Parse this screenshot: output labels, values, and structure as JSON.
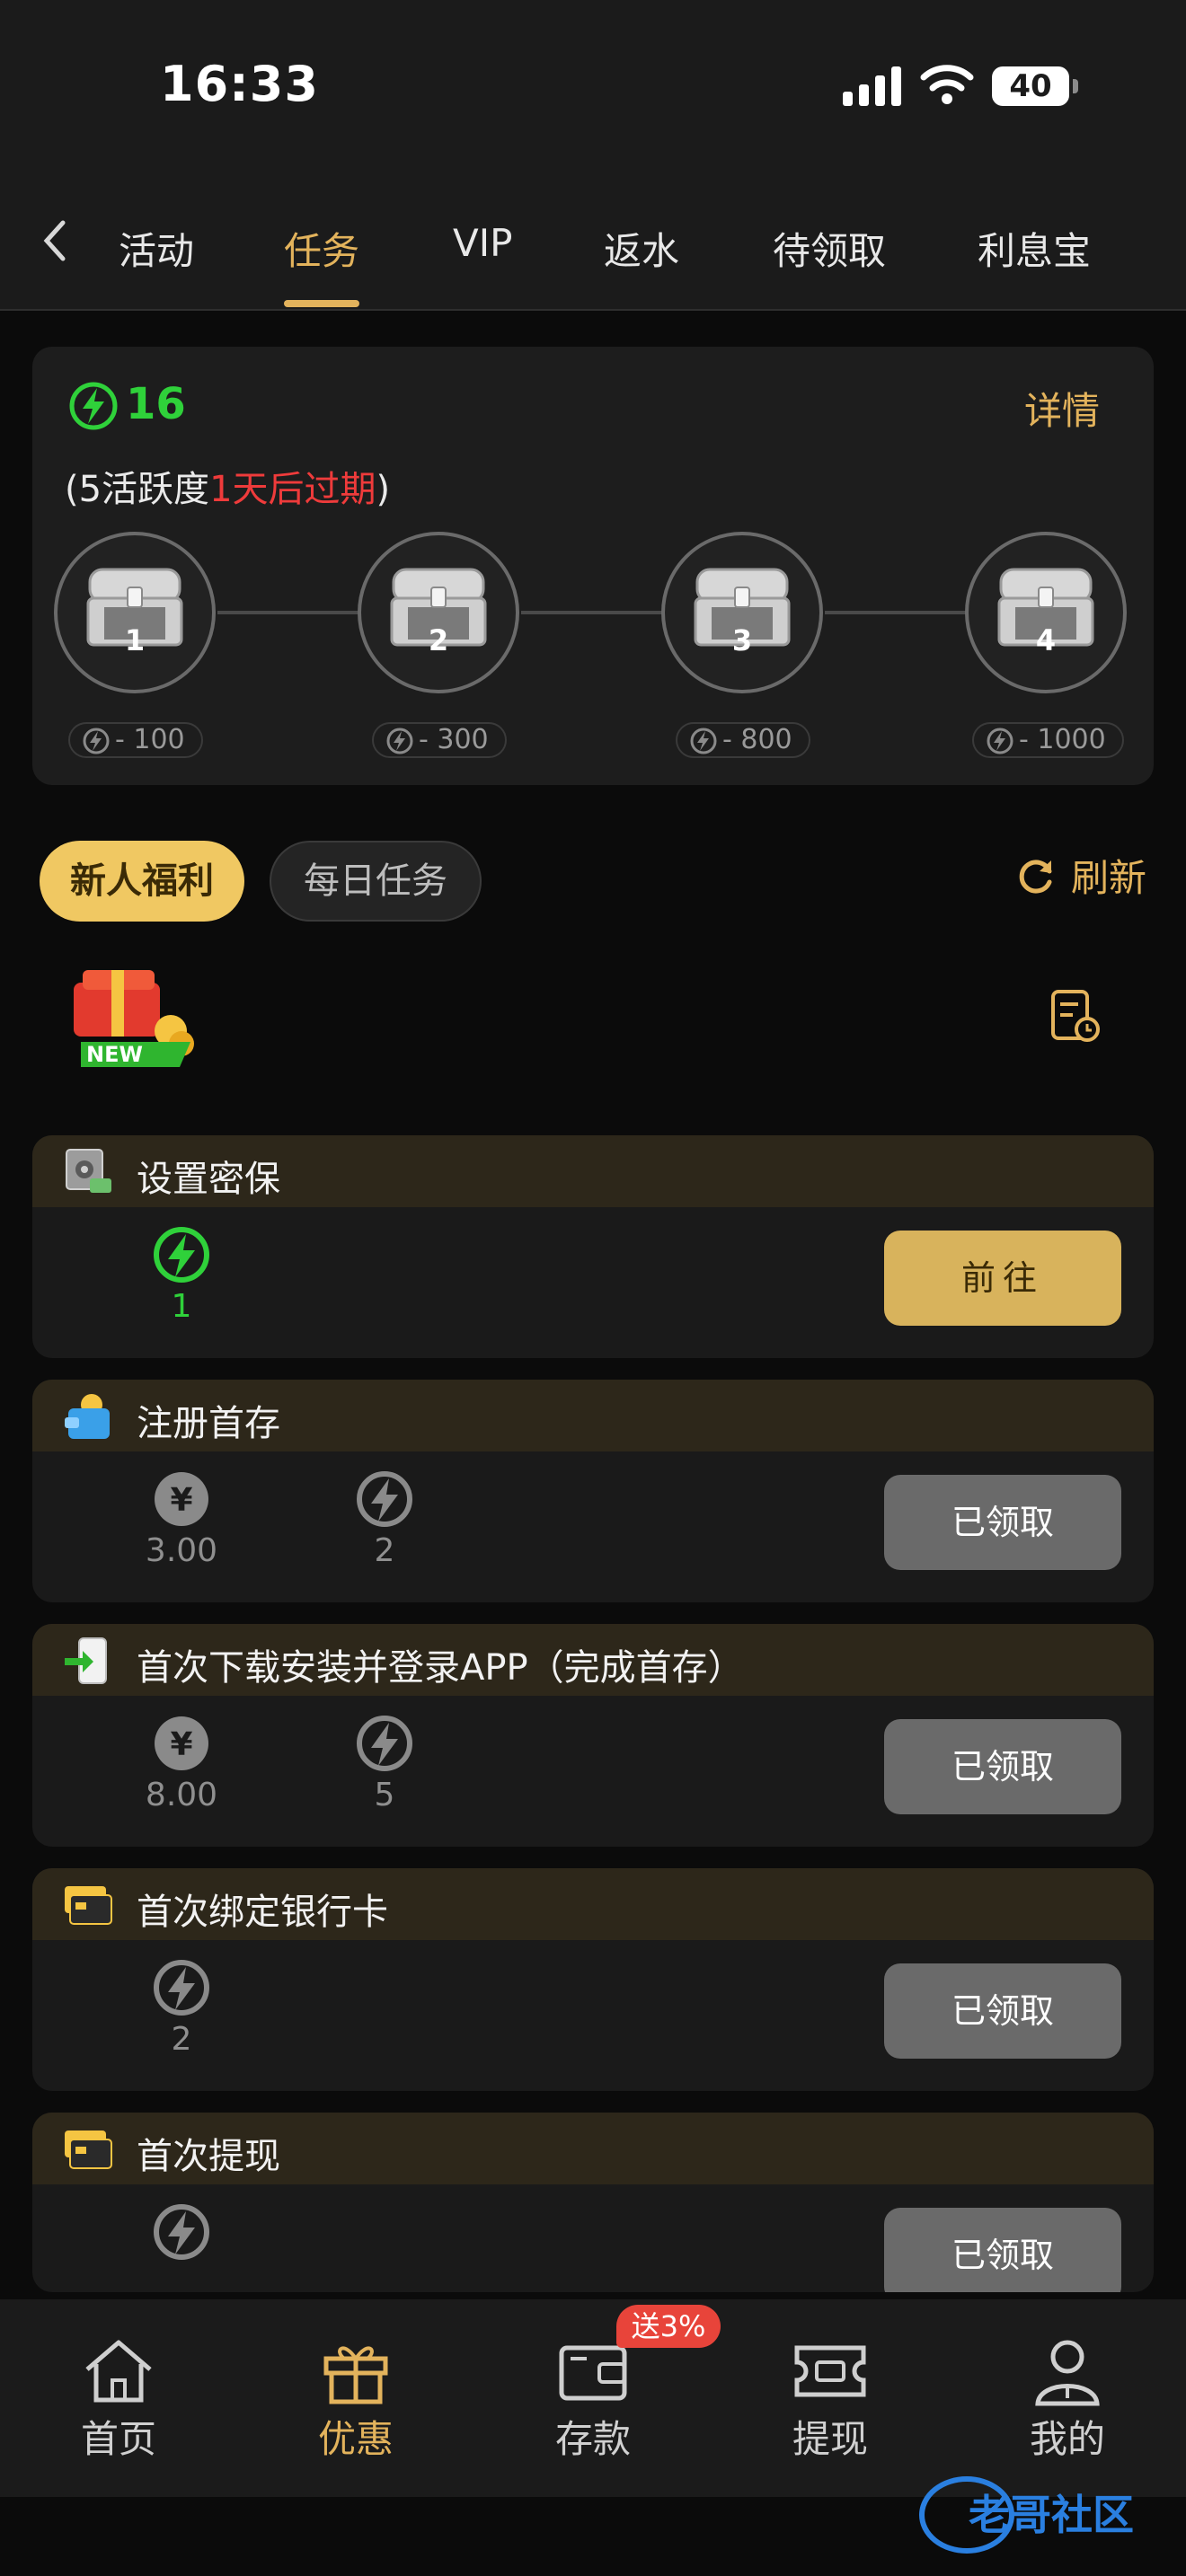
{
  "status_bar": {
    "time": "16:33",
    "battery": "40"
  },
  "tabs": [
    {
      "label": "活动",
      "active": false
    },
    {
      "label": "任务",
      "active": true
    },
    {
      "label": "VIP",
      "active": false
    },
    {
      "label": "返水",
      "active": false
    },
    {
      "label": "待领取",
      "active": false
    },
    {
      "label": "利息宝",
      "active": false
    }
  ],
  "activity": {
    "points": "16",
    "detail_label": "详情",
    "expire_prefix": "(5活跃度",
    "expire_red": "1天后过期",
    "expire_suffix": ")",
    "chests": [
      {
        "num": "1",
        "cost": "- 100"
      },
      {
        "num": "2",
        "cost": "- 300"
      },
      {
        "num": "3",
        "cost": "- 800"
      },
      {
        "num": "4",
        "cost": "- 1000"
      }
    ]
  },
  "filters": {
    "new_user": "新人福利",
    "daily": "每日任务",
    "refresh": "刷新",
    "new_badge": "NEW"
  },
  "tasks": [
    {
      "title": "设置密保",
      "rewards": [
        {
          "type": "activity",
          "value": "1",
          "active": true
        }
      ],
      "button": "前往",
      "button_state": "go"
    },
    {
      "title": "注册首存",
      "rewards": [
        {
          "type": "money",
          "value": "3.00"
        },
        {
          "type": "activity",
          "value": "2"
        }
      ],
      "button": "已领取",
      "button_state": "done"
    },
    {
      "title": "首次下载安装并登录APP（完成首存）",
      "rewards": [
        {
          "type": "money",
          "value": "8.00"
        },
        {
          "type": "activity",
          "value": "5"
        }
      ],
      "button": "已领取",
      "button_state": "done"
    },
    {
      "title": "首次绑定银行卡",
      "rewards": [
        {
          "type": "activity",
          "value": "2"
        }
      ],
      "button": "已领取",
      "button_state": "done"
    },
    {
      "title": "首次提现",
      "rewards": [
        {
          "type": "activity",
          "value": ""
        }
      ],
      "button": "已领取",
      "button_state": "done"
    }
  ],
  "bottom_nav": [
    {
      "label": "首页",
      "icon": "home-icon",
      "active": false
    },
    {
      "label": "优惠",
      "icon": "gift-icon",
      "active": true
    },
    {
      "label": "存款",
      "icon": "wallet-icon",
      "active": false
    },
    {
      "label": "提现",
      "icon": "withdraw-icon",
      "active": false
    },
    {
      "label": "我的",
      "icon": "user-icon",
      "active": false
    }
  ],
  "promo_badge": "送3%",
  "watermark": "老哥社区",
  "colors": {
    "gold": "#e3b35c",
    "green": "#2fd13a",
    "red": "#ef3b3b",
    "background": "#0b0b0b"
  }
}
